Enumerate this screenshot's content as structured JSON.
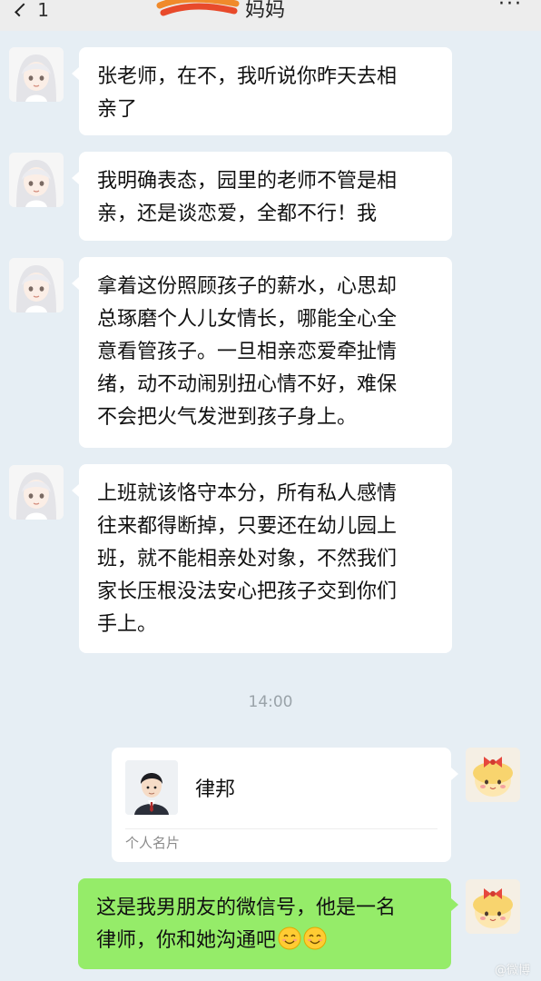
{
  "header": {
    "back_count": "1",
    "title": "妈妈",
    "more": "···"
  },
  "messages": [
    {
      "lines": [
        "张老师，在不，我听说你昨天去相",
        "亲了"
      ]
    },
    {
      "lines": [
        "我明确表态，园里的老师不管是相",
        "亲，还是谈恋爱，全都不行！我"
      ]
    },
    {
      "lines": [
        "拿着这份照顾孩子的薪水，心思却",
        "总琢磨个人儿女情长，哪能全心全",
        "意看管孩子。一旦相亲恋爱牵扯情",
        "绪，动不动闹别扭心情不好，难保",
        "不会把火气发泄到孩子身上。"
      ]
    },
    {
      "lines": [
        "上班就该恪守本分，所有私人感情",
        "往来都得断掉，只要还在幼儿园上",
        "班，就不能相亲处对象，不然我们",
        "家长压根没法安心把孩子交到你们",
        "手上。"
      ]
    }
  ],
  "time_divider": "14:00",
  "contact_card": {
    "name": "律邦",
    "type": "个人名片"
  },
  "reply": {
    "lines": [
      "这是我男朋友的微信号，他是一名",
      "律师，你和她沟通吧"
    ],
    "emoji": [
      "smiling-face",
      "smiling-face"
    ]
  },
  "watermark": "@微博",
  "colors": {
    "background": "#e6eef4",
    "bubble_in": "#ffffff",
    "bubble_out": "#95ec69",
    "header": "#ededed"
  }
}
